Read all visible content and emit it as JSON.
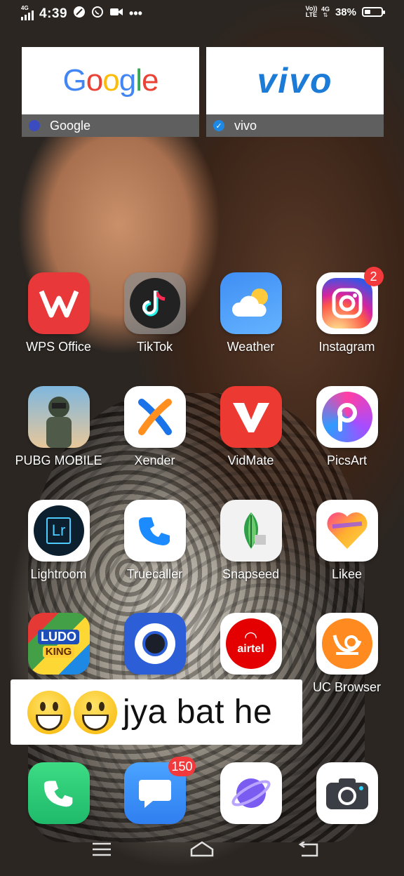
{
  "status_bar": {
    "network_left": "4G",
    "time": "4:39",
    "network_right_volte": "Vo)) LTE",
    "network_right": "4G",
    "battery_percent": "38%",
    "battery_level": 0.38
  },
  "widgets": [
    {
      "brand": "Google",
      "label": "Google"
    },
    {
      "brand": "vivo",
      "label": "vivo"
    }
  ],
  "apps": [
    {
      "label": "WPS Office",
      "icon": "wps-office-icon"
    },
    {
      "label": "TikTok",
      "icon": "tiktok-icon"
    },
    {
      "label": "Weather",
      "icon": "weather-icon"
    },
    {
      "label": "Instagram",
      "icon": "instagram-icon",
      "badge": "2"
    },
    {
      "label": "PUBG MOBILE",
      "icon": "pubg-icon"
    },
    {
      "label": "Xender",
      "icon": "xender-icon"
    },
    {
      "label": "VidMate",
      "icon": "vidmate-icon"
    },
    {
      "label": "PicsArt",
      "icon": "picsart-icon"
    },
    {
      "label": "Lightroom",
      "icon": "lightroom-icon"
    },
    {
      "label": "Truecaller",
      "icon": "truecaller-icon"
    },
    {
      "label": "Snapseed",
      "icon": "snapseed-icon"
    },
    {
      "label": "Likee",
      "icon": "likee-icon"
    },
    {
      "label": "",
      "icon": "ludo-king-icon"
    },
    {
      "label": "",
      "icon": "camera-app-icon"
    },
    {
      "label": "",
      "icon": "airtel-icon",
      "text": "airtel"
    },
    {
      "label": "UC Browser",
      "icon": "uc-browser-icon"
    }
  ],
  "dock": [
    {
      "icon": "phone-icon"
    },
    {
      "icon": "messages-icon",
      "badge": "150"
    },
    {
      "icon": "browser-icon"
    },
    {
      "icon": "camera-icon"
    }
  ],
  "caption": {
    "text": "jya bat he"
  },
  "icon_text": {
    "lightroom": "Lr",
    "ludo_top": "LUDO",
    "ludo_bottom": "KING"
  }
}
